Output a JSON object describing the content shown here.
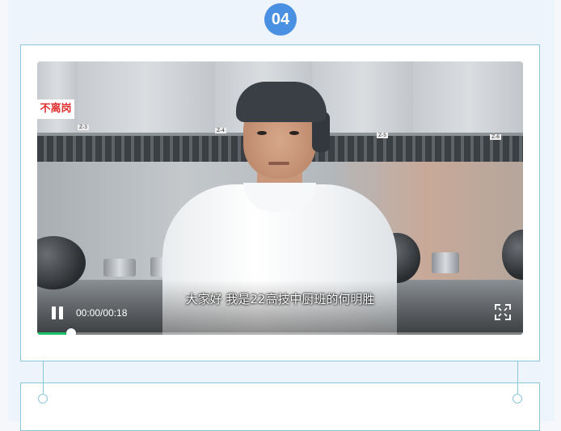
{
  "step": {
    "number": "04"
  },
  "video": {
    "sign_text": "不离岗",
    "station_tags": [
      "Z-3",
      "Z-4",
      "Z-5",
      "Z-6"
    ],
    "subtitle": "大家好 我是22高技中厨班的何明胜",
    "time_display": "00:00/00:18",
    "progress_fraction": 0.07,
    "state": "paused"
  },
  "colors": {
    "accent": "#4a90e2",
    "card_border": "#8cc6db",
    "progress": "#1cc46a"
  }
}
